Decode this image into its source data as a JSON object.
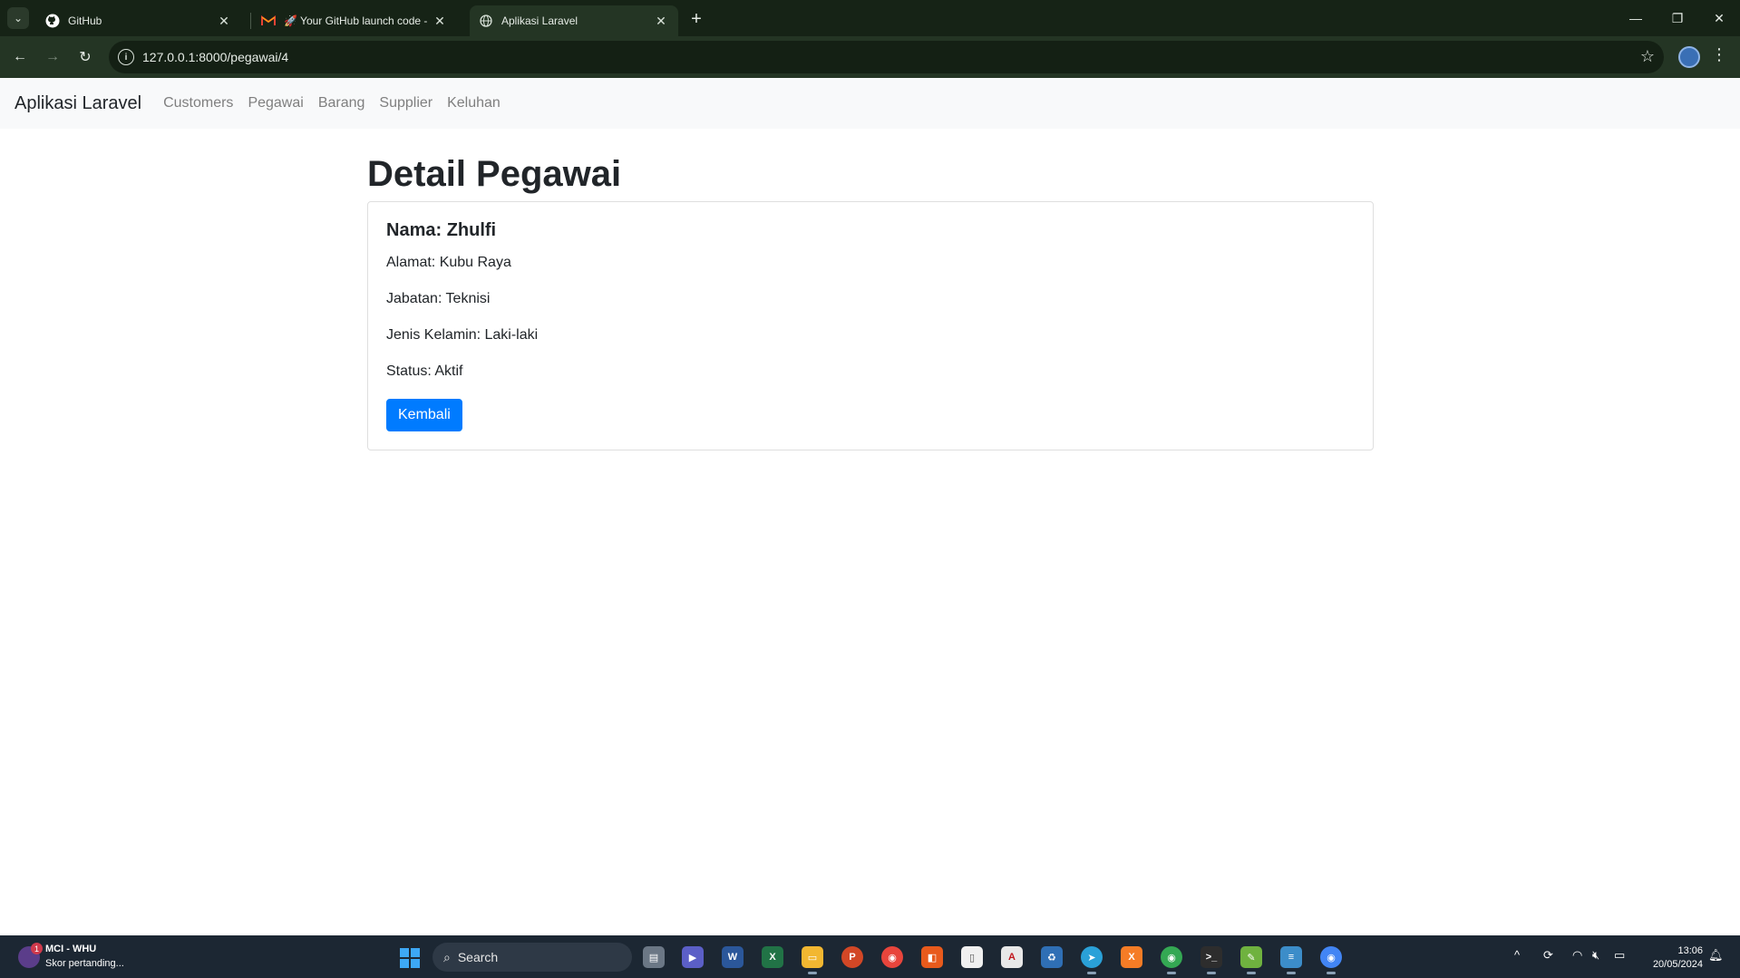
{
  "browser": {
    "tabs": [
      {
        "title": "GitHub",
        "favicon": "github-icon"
      },
      {
        "title": "🚀 Your GitHub launch code - ",
        "favicon": "gmail-icon"
      },
      {
        "title": "Aplikasi Laravel",
        "favicon": "globe-icon"
      }
    ],
    "active_tab": 2,
    "url": "127.0.0.1:8000/pegawai/4"
  },
  "navbar": {
    "brand": "Aplikasi Laravel",
    "links": [
      "Customers",
      "Pegawai",
      "Barang",
      "Supplier",
      "Keluhan"
    ]
  },
  "page": {
    "title": "Detail Pegawai",
    "card": {
      "name_line": "Nama: Zhulfi",
      "alamat": "Alamat: Kubu Raya",
      "jabatan": "Jabatan: Teknisi",
      "jenis_kelamin": "Jenis Kelamin: Laki-laki",
      "status": "Status: Aktif"
    },
    "back_button": "Kembali"
  },
  "taskbar": {
    "news_title": "MCI - WHU",
    "news_subtitle": "Skor pertanding...",
    "news_badge": "1",
    "search_label": "Search",
    "time": "13:06",
    "date": "20/05/2024"
  },
  "colors": {
    "primary": "#007bff",
    "chrome_dark": "#162316",
    "navbar_bg": "#f8f9fa"
  }
}
